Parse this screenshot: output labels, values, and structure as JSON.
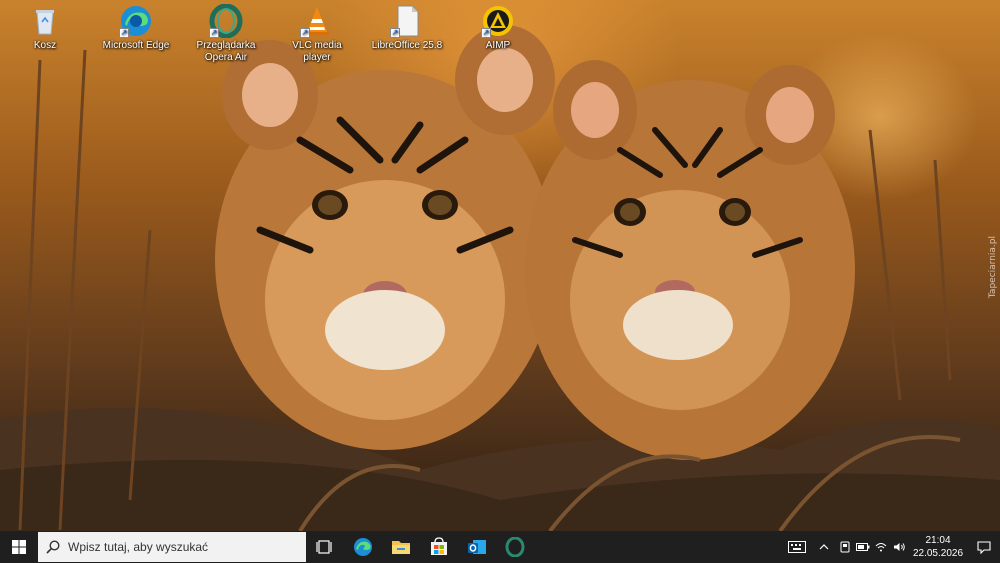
{
  "desktop": {
    "icons": [
      {
        "label": "Kosz",
        "icon": "recycle-bin-icon"
      },
      {
        "label": "Microsoft Edge",
        "icon": "edge-icon"
      },
      {
        "label": "Przeglądarka Opera Air",
        "icon": "opera-icon"
      },
      {
        "label": "VLC media player",
        "icon": "vlc-icon"
      },
      {
        "label": "LibreOffice 25.8",
        "icon": "libreoffice-icon"
      },
      {
        "label": "AIMP",
        "icon": "aimp-icon"
      }
    ],
    "watermark": "Tapeciarnia.pl"
  },
  "taskbar": {
    "search_placeholder": "Wpisz tutaj, aby wyszukać",
    "apps": [
      "task-view-icon",
      "edge-icon",
      "file-explorer-icon",
      "store-icon",
      "outlook-icon",
      "opera-icon"
    ],
    "tray": {
      "icons": [
        "keyboard-icon",
        "chevron-up-icon",
        "device-icon",
        "battery-icon",
        "network-icon",
        "volume-icon"
      ]
    },
    "clock": {
      "time": "21:04",
      "date": "22.05.2026"
    }
  },
  "colors": {
    "taskbar": "#1f1f1f",
    "search": "#f2f2f2",
    "accent": "#0078d4"
  }
}
